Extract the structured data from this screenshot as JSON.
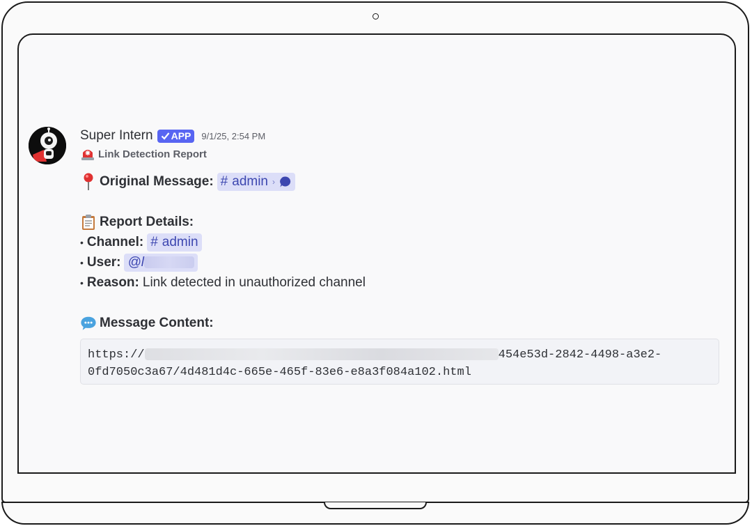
{
  "message": {
    "author": "Super Intern",
    "badge": "APP",
    "timestamp": "9/1/25, 2:54 PM",
    "subtitle": "Link Detection Report",
    "original_label": "Original Message:",
    "original_channel": "admin",
    "details_label": "Report Details:",
    "channel_label": "Channel:",
    "channel_value": "admin",
    "user_label": "User:",
    "user_value": "@l",
    "reason_label": "Reason:",
    "reason_value": "Link detected in unauthorized channel",
    "content_label": "Message Content:",
    "code_line1_start": "https://",
    "code_line1_end": "454e53d-2842-4498-a3e2-",
    "code_line2": "0fd7050c3a67/4d481d4c-665e-465f-83e6-e8a3f084a102.html"
  },
  "icons": {
    "siren": "rotating-light-icon",
    "pin": "round-pushpin-icon",
    "clipboard": "clipboard-icon",
    "speech": "speech-balloon-icon"
  },
  "colors": {
    "badge": "#5865f2",
    "mention_bg": "#dcdef8",
    "mention_text": "#3d47b0"
  }
}
